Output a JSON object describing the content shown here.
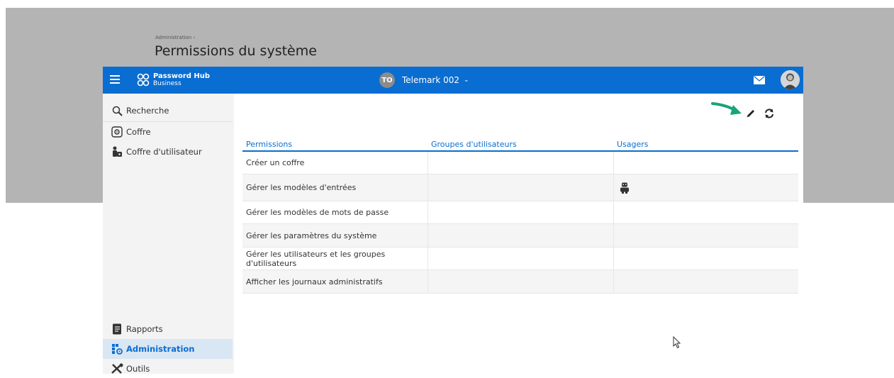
{
  "topbar": {
    "logo_line1": "Password Hub",
    "logo_line2": "Business",
    "org_initials": "TO",
    "org_name": "Telemark 002"
  },
  "sidebar": {
    "items": [
      {
        "label": "Recherche",
        "icon": "search-icon"
      },
      {
        "label": "Coffre",
        "icon": "vault-icon"
      },
      {
        "label": "Coffre d'utilisateur",
        "icon": "user-vault-icon"
      },
      {
        "label": "Rapports",
        "icon": "report-icon"
      },
      {
        "label": "Administration",
        "icon": "admin-icon",
        "active": true
      },
      {
        "label": "Outils",
        "icon": "tools-icon"
      }
    ]
  },
  "main": {
    "breadcrumb": "Administration ›",
    "title": "Permissions du système"
  },
  "table": {
    "headers": [
      "Permissions",
      "Groupes d'utilisateurs",
      "Usagers"
    ],
    "rows": [
      {
        "permission": "Créer un coffre",
        "groups": "",
        "users_icon": ""
      },
      {
        "permission": "Gérer les modèles d'entrées",
        "groups": "",
        "users_icon": "robot-user-icon"
      },
      {
        "permission": "Gérer les modèles de mots de passe",
        "groups": "",
        "users_icon": ""
      },
      {
        "permission": "Gérer les paramètres du système",
        "groups": "",
        "users_icon": ""
      },
      {
        "permission": "Gérer les utilisateurs et les groupes d'utilisateurs",
        "groups": "",
        "users_icon": ""
      },
      {
        "permission": "Afficher les journaux administratifs",
        "groups": "",
        "users_icon": ""
      }
    ]
  },
  "colors": {
    "brand": "#0a6dd1",
    "active_bg": "#d9e6f4",
    "annotation_arrow": "#1aa37a"
  }
}
